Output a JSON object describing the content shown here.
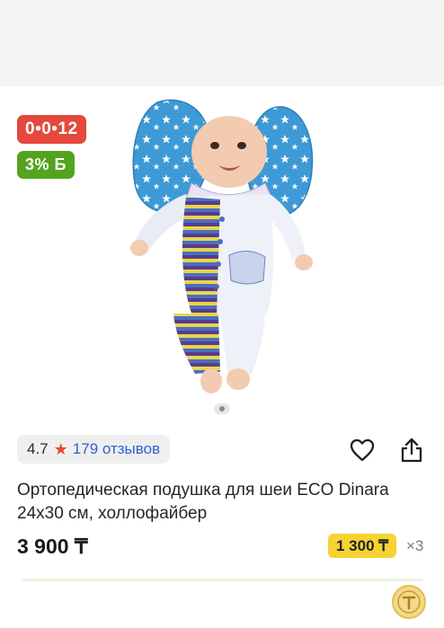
{
  "badges": {
    "installment": "0•0•12",
    "bonus": "3% Б"
  },
  "gallery": {
    "image_description": "product-photo",
    "dots_count": 1
  },
  "rating": {
    "value": "4.7",
    "star_icon": "star-icon",
    "reviews": "179 отзывов"
  },
  "actions": {
    "favorite_icon": "heart-icon",
    "share_icon": "share-icon"
  },
  "product": {
    "title": "Ортопедическая подушка для шеи ECO Dinara 24x30 см, холлофайбер",
    "price": "3 900 ₸",
    "installment_price": "1 300 ₸",
    "installment_multiplier": "×3"
  },
  "colors": {
    "installment_badge": "#e5483c",
    "bonus_badge": "#53a31f",
    "installment_chip": "#f7d233",
    "link": "#2b63d6",
    "star": "#e5483c"
  }
}
